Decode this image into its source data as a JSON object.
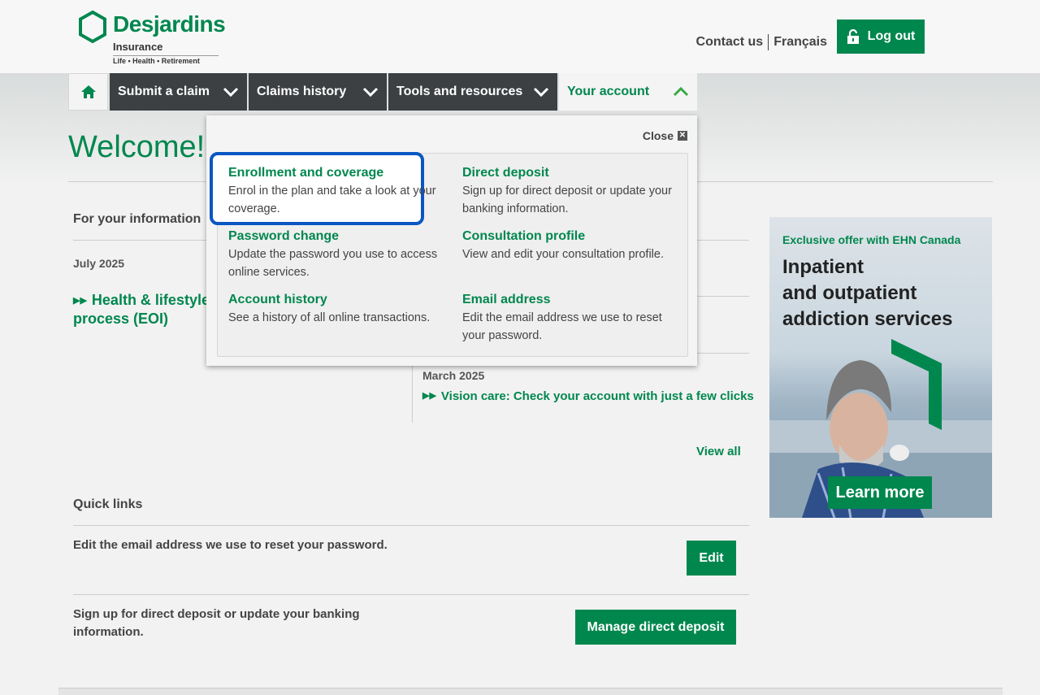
{
  "brand": {
    "name": "Desjardins",
    "sub": "Insurance",
    "tagline": "Life • Health • Retirement",
    "color": "#00874e"
  },
  "header": {
    "contact": "Contact us",
    "language": "Français",
    "logout": "Log out"
  },
  "nav": {
    "home_icon": "home-icon",
    "items": [
      {
        "label": "Submit a claim"
      },
      {
        "label": "Claims history"
      },
      {
        "label": "Tools and resources"
      },
      {
        "label": "Your account"
      }
    ]
  },
  "welcome": "Welcome!",
  "info": {
    "title": "For your information",
    "date1": "July 2025",
    "link1": "Health & lifestyle process (EOI)",
    "date2": "March 2025",
    "link2": "Vision care: Check your account with just a few clicks",
    "view_all": "View all"
  },
  "quick_links": {
    "title": "Quick links",
    "items": [
      {
        "text": "Edit the email address we use to reset your password.",
        "button": "Edit"
      },
      {
        "text": "Sign up for direct deposit or update your banking information.",
        "button": "Manage direct deposit"
      }
    ]
  },
  "ad": {
    "offer": "Exclusive offer with EHN Canada",
    "title_lines": [
      "Inpatient",
      "and outpatient",
      "addiction services"
    ],
    "button": "Learn more"
  },
  "menu": {
    "close": "Close",
    "items": [
      {
        "title": "Enrollment and coverage",
        "desc": "Enrol in the plan and take a look at your coverage."
      },
      {
        "title": "Direct deposit",
        "desc": "Sign up for direct deposit or update your banking information."
      },
      {
        "title": "Password change",
        "desc": "Update the password you use to access online services."
      },
      {
        "title": "Consultation profile",
        "desc": "View and edit your consultation profile."
      },
      {
        "title": "Account history",
        "desc": "See a history of all online transactions."
      },
      {
        "title": "Email address",
        "desc": "Edit the email address we use to reset your password."
      }
    ]
  }
}
